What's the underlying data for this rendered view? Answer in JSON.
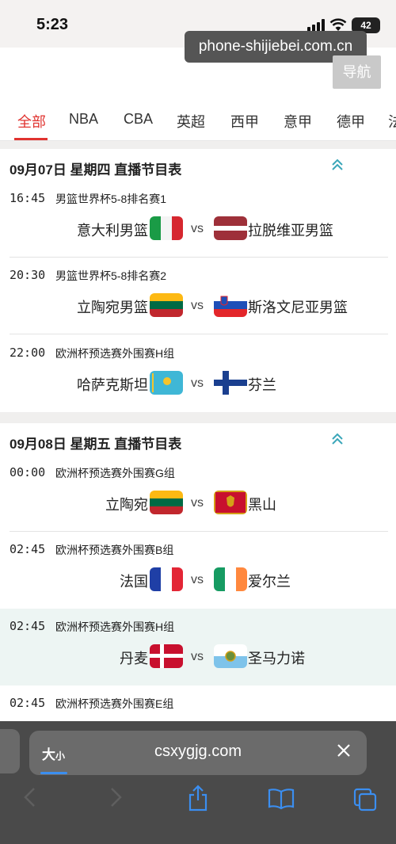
{
  "status": {
    "time": "5:23",
    "battery": "42"
  },
  "overlay": {
    "domain": "phone-shijiebei.com.cn",
    "nav_button": "导航"
  },
  "tabs": [
    "全部",
    "NBA",
    "CBA",
    "英超",
    "西甲",
    "意甲",
    "德甲",
    "法"
  ],
  "sections": [
    {
      "title": "09月07日 星期四 直播节目表",
      "matches": [
        {
          "time": "16:45",
          "league": "男篮世界杯5-8排名赛1",
          "home": "意大利男篮",
          "away": "拉脱维亚男篮",
          "home_flag": "italy",
          "away_flag": "latvia"
        },
        {
          "time": "20:30",
          "league": "男篮世界杯5-8排名赛2",
          "home": "立陶宛男篮",
          "away": "斯洛文尼亚男篮",
          "home_flag": "lithuania",
          "away_flag": "slovenia"
        },
        {
          "time": "22:00",
          "league": "欧洲杯预选赛外围赛H组",
          "home": "哈萨克斯坦",
          "away": "芬兰",
          "home_flag": "kazakhstan",
          "away_flag": "finland"
        }
      ]
    },
    {
      "title": "09月08日 星期五 直播节目表",
      "matches": [
        {
          "time": "00:00",
          "league": "欧洲杯预选赛外围赛G组",
          "home": "立陶宛",
          "away": "黑山",
          "home_flag": "lithuania",
          "away_flag": "montenegro"
        },
        {
          "time": "02:45",
          "league": "欧洲杯预选赛外围赛B组",
          "home": "法国",
          "away": "爱尔兰",
          "home_flag": "france",
          "away_flag": "ireland"
        },
        {
          "time": "02:45",
          "league": "欧洲杯预选赛外围赛H组",
          "home": "丹麦",
          "away": "圣马力诺",
          "home_flag": "denmark",
          "away_flag": "san-marino"
        },
        {
          "time": "02:45",
          "league": "欧洲杯预选赛外围赛E组",
          "home": "",
          "away": "",
          "home_flag": "",
          "away_flag": ""
        }
      ]
    }
  ],
  "vs_label": "vs",
  "browser": {
    "aa_big": "大",
    "aa_small": "小",
    "url": "csxygjg.com"
  },
  "colors": {
    "accent": "#e0332f",
    "link_blue": "#3b8ef0"
  }
}
